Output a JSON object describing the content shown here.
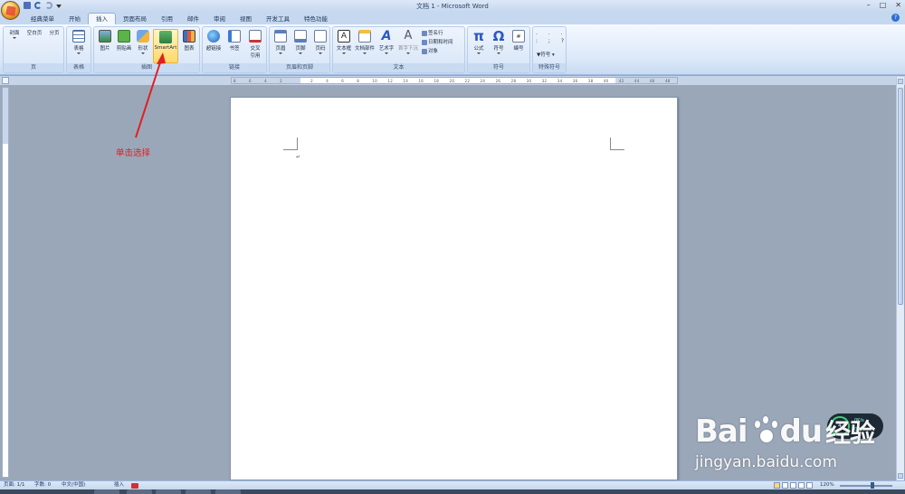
{
  "window": {
    "title": "文档 1 - Microsoft Word",
    "controls": [
      "–",
      "□",
      "✕"
    ]
  },
  "tabs": [
    "经典菜单",
    "开始",
    "插入",
    "页面布局",
    "引用",
    "邮件",
    "审阅",
    "视图",
    "开发工具",
    "特色功能"
  ],
  "active_tab": "插入",
  "ribbon": {
    "groups": {
      "pages": {
        "label": "页",
        "buttons": [
          "封面",
          "空白页",
          "分页"
        ]
      },
      "tables": {
        "label": "表格",
        "buttons": [
          "表格"
        ]
      },
      "illustrations": {
        "label": "插图",
        "buttons": [
          "图片",
          "剪贴画",
          "形状",
          "SmartArt",
          "图表"
        ]
      },
      "links": {
        "label": "链接",
        "buttons": [
          "超链接",
          "书签",
          "交叉",
          "引用"
        ]
      },
      "header_footer": {
        "label": "页眉和页脚",
        "buttons": [
          "页眉",
          "页脚",
          "页码"
        ]
      },
      "text": {
        "label": "文本",
        "buttons": [
          "文本框",
          "文档部件",
          "艺术字",
          "首字下沉"
        ],
        "small": [
          "签名行",
          "日期和时间",
          "对象"
        ]
      },
      "symbols": {
        "label": "符号",
        "buttons": [
          "公式",
          "符号",
          "编号"
        ]
      },
      "special": {
        "label": "特殊符号",
        "small": [
          "符号"
        ]
      }
    }
  },
  "ruler": {
    "numbers": [
      "8",
      "6",
      "4",
      "2",
      "",
      "2",
      "4",
      "6",
      "8",
      "10",
      "12",
      "14",
      "16",
      "18",
      "20",
      "22",
      "24",
      "26",
      "28",
      "30",
      "32",
      "34",
      "36",
      "38",
      "40",
      "42",
      "44",
      "46",
      "48"
    ]
  },
  "annotation": {
    "text": "单击选择",
    "color": "#e02020"
  },
  "status": {
    "page": "页面: 1/1",
    "words": "字数: 0",
    "language": "中文(中国)",
    "mode": "插入",
    "zoom": "120%"
  },
  "watermark": {
    "line1": "Bai",
    "line1b": "du",
    "line1c": "经验",
    "line2": "jingyan.baidu.com"
  },
  "net_widget": {
    "value": "4",
    "up": "0K/s",
    "down": "0K/s"
  },
  "colors": {
    "ribbon_bg": "#dbe8f8",
    "highlight": "#ffd86b",
    "annotation": "#e02020"
  }
}
